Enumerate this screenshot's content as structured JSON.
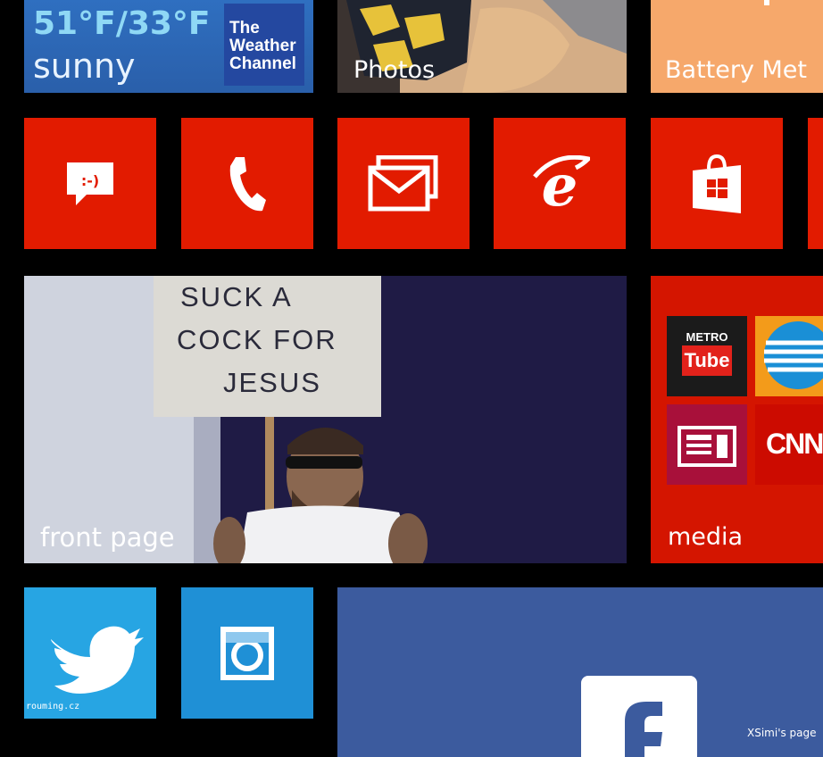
{
  "weather": {
    "temperature": "51°F/33°F",
    "condition": "sunny",
    "provider_line1": "The",
    "provider_line2": "Weather",
    "provider_line3": "Channel"
  },
  "photos": {
    "label": "Photos"
  },
  "battery": {
    "label": "Battery Met"
  },
  "apps": [
    {
      "name": "Messaging",
      "icon": "messaging-icon",
      "emoticon": ":-)"
    },
    {
      "name": "Phone",
      "icon": "phone-icon"
    },
    {
      "name": "Mail",
      "icon": "mail-icon"
    },
    {
      "name": "Internet Explorer",
      "icon": "ie-icon"
    },
    {
      "name": "Store",
      "icon": "store-icon"
    }
  ],
  "front_page": {
    "label": "front page",
    "sign_line1": "SUCK  A",
    "sign_line2": "COCK  FOR",
    "sign_line3": "JESUS"
  },
  "media": {
    "label": "media",
    "metro_top": "METRO",
    "metro_bottom": "Tube",
    "cnn": "CNN"
  },
  "social": [
    {
      "name": "Twitter",
      "icon": "twitter-icon"
    },
    {
      "name": "Instagram",
      "icon": "instagram-icon"
    },
    {
      "name": "Facebook",
      "icon": "facebook-icon"
    }
  ],
  "watermarks": {
    "left": "rouming.cz",
    "right": "XSimi's page"
  },
  "colors": {
    "app_red": "#e21b00",
    "weather_blue": "#2f6fc0",
    "battery_orange": "#f6a86b",
    "twitter_blue": "#27a5e3",
    "facebook_blue": "#3c5b9e"
  }
}
